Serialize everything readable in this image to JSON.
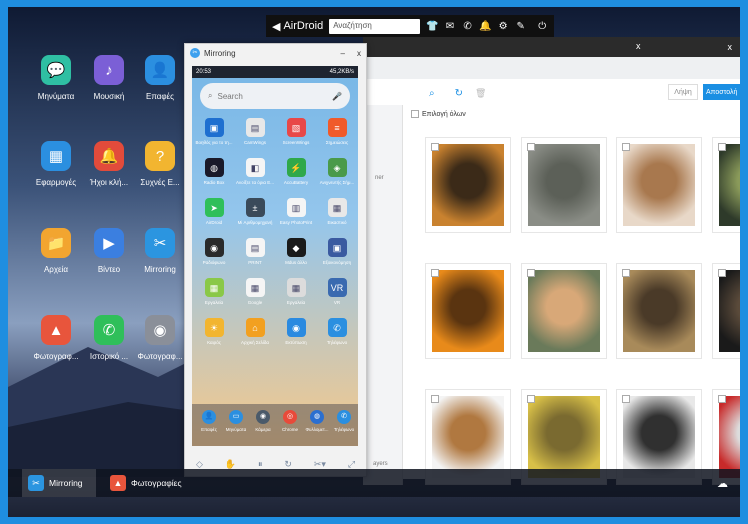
{
  "topbar": {
    "brand": "AirDroid",
    "search_placeholder": "Αναζήτηση",
    "icons": [
      "tshirt-icon",
      "mail-icon",
      "phone-icon",
      "bell-icon",
      "gear-icon",
      "pen-icon",
      "power-icon"
    ]
  },
  "desktop": {
    "icons": [
      {
        "label": "Μηνύματα",
        "color": "#2fbfa3",
        "glyph": "💬"
      },
      {
        "label": "Μουσική",
        "color": "#7b5fd6",
        "glyph": "♪"
      },
      {
        "label": "Επαφές",
        "color": "#2b8fe0",
        "glyph": "👤"
      },
      {
        "label": "Εφαρμογές",
        "color": "#2b8fe0",
        "glyph": "▦"
      },
      {
        "label": "Ήχοι κλή...",
        "color": "#e24b3b",
        "glyph": "🔔"
      },
      {
        "label": "Συχνές Ε...",
        "color": "#f2b530",
        "glyph": "?"
      },
      {
        "label": "Αρχεία",
        "color": "#f2a530",
        "glyph": "📁"
      },
      {
        "label": "Βίντεο",
        "color": "#3b7fe0",
        "glyph": "▶"
      },
      {
        "label": "Mirroring",
        "color": "#2b95e0",
        "glyph": "✂"
      },
      {
        "label": "Φωτογραφ...",
        "color": "#e8553c",
        "glyph": "▲"
      },
      {
        "label": "Ιστορικό ...",
        "color": "#2fbf5a",
        "glyph": "✆"
      },
      {
        "label": "Φωτογραφ...",
        "color": "#8a8f99",
        "glyph": "◉"
      }
    ]
  },
  "app": {
    "close": "x",
    "btn_light": "Λήψη",
    "btn_blue": "Αποστολή",
    "select_all": "Επιλογή όλων",
    "side_texts": [
      "ner",
      "ayers"
    ],
    "photos": [
      {
        "c1": "#c9822f",
        "c2": "#3b2a18"
      },
      {
        "c1": "#8a8d86",
        "c2": "#5c6058"
      },
      {
        "c1": "#e8d8c8",
        "c2": "#a8784e"
      },
      {
        "c1": "#2e3a2a",
        "c2": "#8a9a5a"
      },
      {
        "c1": "#e88a1a",
        "c2": "#5a3410"
      },
      {
        "c1": "#6a7a5a",
        "c2": "#d8a878"
      },
      {
        "c1": "#a88a5a",
        "c2": "#4a3a28"
      },
      {
        "c1": "#1a1a1a",
        "c2": "#5a4a3a"
      },
      {
        "c1": "#f4f4f4",
        "c2": "#b07840"
      },
      {
        "c1": "#d8c048",
        "c2": "#7a6a30"
      },
      {
        "c1": "#e8e8e8",
        "c2": "#303030"
      },
      {
        "c1": "#c82a2a",
        "c2": "#dcdcdc"
      }
    ]
  },
  "mirror": {
    "title": "Mirroring",
    "minimize": "–",
    "close": "x",
    "status_left": "20:53",
    "status_right": "45,2KB/s",
    "search_placeholder": "Search",
    "apps": [
      {
        "label": "Βοηθός για το τη...",
        "color": "#1e6fd0",
        "glyph": "▣"
      },
      {
        "label": "CamWings",
        "color": "#e8e8e8",
        "glyph": "▤"
      },
      {
        "label": "ScreenWings",
        "color": "#e84848",
        "glyph": "▧"
      },
      {
        "label": "Σημειώσεις",
        "color": "#f05a2a",
        "glyph": "≡"
      },
      {
        "label": "Radio Box",
        "color": "#1a1a2a",
        "glyph": "◍"
      },
      {
        "label": "Ανοίξτε τα όρια E...",
        "color": "#f5f5f5",
        "glyph": "◧"
      },
      {
        "label": "AccuBattery",
        "color": "#2fa84a",
        "glyph": "⚡"
      },
      {
        "label": "Ανιχνευτής Σήμ...",
        "color": "#4a9a4a",
        "glyph": "◈"
      },
      {
        "label": "AirDroid",
        "color": "#2fbf5a",
        "glyph": "➤"
      },
      {
        "label": "Mi Αριθμομηχανή",
        "color": "#3a4a5a",
        "glyph": "±"
      },
      {
        "label": "Easy PhotoPrint",
        "color": "#f5f5f5",
        "glyph": "▥"
      },
      {
        "label": "Εικαστικό",
        "color": "#e8e8e8",
        "glyph": "▦"
      },
      {
        "label": "Ραδιόφωνο",
        "color": "#2a2a2a",
        "glyph": "◉"
      },
      {
        "label": "PRINT",
        "color": "#f5f5f5",
        "glyph": "▤"
      },
      {
        "label": "Mdus άλλο",
        "color": "#1a1a1a",
        "glyph": "◆"
      },
      {
        "label": "Εξοικονόμηση",
        "color": "#3a5aa0",
        "glyph": "▣"
      },
      {
        "label": "Εργαλεία",
        "color": "#8ac848",
        "glyph": "▦"
      },
      {
        "label": "Google",
        "color": "#f5f5f5",
        "glyph": "▦"
      },
      {
        "label": "Εργαλεία",
        "color": "#dcdcdc",
        "glyph": "▦"
      },
      {
        "label": "VR",
        "color": "#3a6ab0",
        "glyph": "VR"
      },
      {
        "label": "Καιρός",
        "color": "#f2b530",
        "glyph": "☀"
      },
      {
        "label": "Αρχική Σελίδα",
        "color": "#f2a020",
        "glyph": "⌂"
      },
      {
        "label": "Εκτύπωση",
        "color": "#2a8ae0",
        "glyph": "◉"
      },
      {
        "label": "Τηλέφωνο",
        "color": "#2b8fe0",
        "glyph": "✆"
      }
    ],
    "dock": [
      {
        "label": "Επαφές",
        "color": "#2b8fe0",
        "glyph": "👤"
      },
      {
        "label": "Μηνύματα",
        "color": "#2b8fe0",
        "glyph": "▭"
      },
      {
        "label": "Κάμερα",
        "color": "#4a5a6a",
        "glyph": "◉"
      },
      {
        "label": "Chrome",
        "color": "#e84a3a",
        "glyph": "◎"
      },
      {
        "label": "Φυλλομετ...",
        "color": "#2b6fd0",
        "glyph": "◍"
      },
      {
        "label": "Τηλέφωνο",
        "color": "#2b8fe0",
        "glyph": "✆"
      }
    ],
    "controls": [
      "◇",
      "✋",
      "⏸",
      "↻",
      "✂▾",
      "⤢"
    ]
  },
  "taskbar": {
    "items": [
      {
        "label": "Mirroring",
        "color": "#2b95e0",
        "glyph": "✂",
        "active": true
      },
      {
        "label": "Φωτογραφίες",
        "color": "#e8553c",
        "glyph": "▲",
        "active": false
      }
    ]
  }
}
